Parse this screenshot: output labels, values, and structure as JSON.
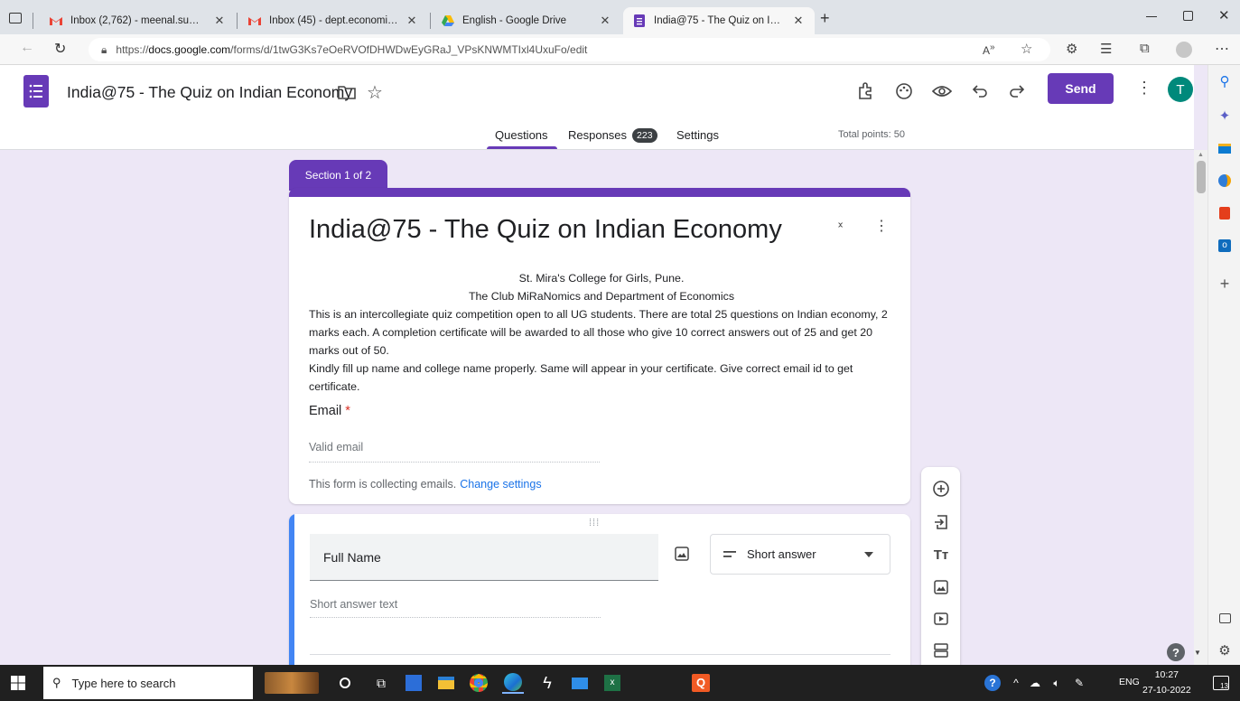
{
  "browser": {
    "tabs": [
      {
        "title": "Inbox (2,762) - meenal.sumant@",
        "icon": "gmail-icon"
      },
      {
        "title": "Inbox (45) - dept.economics@st",
        "icon": "gmail-icon"
      },
      {
        "title": "English - Google Drive",
        "icon": "drive-icon"
      },
      {
        "title": "India@75 - The Quiz on Indian E",
        "icon": "forms-icon"
      }
    ],
    "url_scheme": "https://",
    "url_host": "docs.google.com",
    "url_path": "/forms/d/1twG3Ks7eOeRVOfDHWDwEyGRaJ_VPsKNWMTIxl4UxuFo/edit"
  },
  "header": {
    "title": "India@75 - The Quiz on Indian Economy",
    "send_label": "Send",
    "avatar_letter": "T",
    "tabs": {
      "questions": "Questions",
      "responses": "Responses",
      "responses_count": "223",
      "settings": "Settings"
    },
    "total_points": "Total points: 50"
  },
  "section": {
    "label": "Section 1 of 2",
    "title": "India@75 - The Quiz on Indian Economy",
    "desc_line1": "St. Mira's College for Girls, Pune.",
    "desc_line2": "The Club MiRaNomics and Department of Economics",
    "desc_para1": "This is an intercollegiate quiz competition open to all UG students. There are total 25 questions on Indian economy, 2 marks each. A completion certificate will be awarded to all those who give 10 correct answers out of 25 and get 20 marks out of 50.",
    "desc_para2": "Kindly fill up name and college name properly. Same will appear in your certificate. Give correct email id to get certificate.",
    "email_label": "Email",
    "required_mark": "*",
    "email_placeholder": "Valid email",
    "collecting_text": "This form is collecting emails.",
    "change_settings": "Change settings"
  },
  "question": {
    "title": "Full Name",
    "type": "Short answer",
    "placeholder": "Short answer text"
  },
  "taskbar": {
    "search_placeholder": "Type here to search",
    "lang": "ENG",
    "time": "10:27",
    "date": "27-10-2022",
    "notifications": "13"
  },
  "colors": {
    "accent": "#673ab7",
    "question_bar": "#4285f4",
    "link": "#1a73e8"
  }
}
